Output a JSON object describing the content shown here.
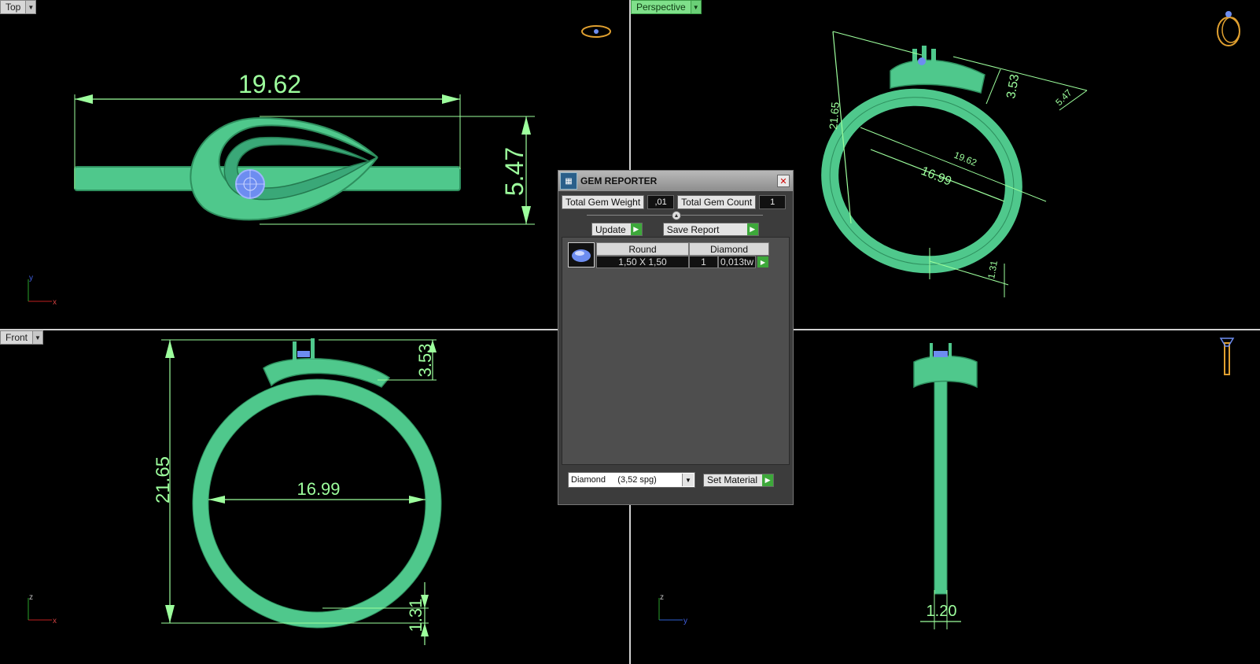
{
  "viewports": {
    "top": {
      "label": "Top",
      "dim_length": "19.62",
      "dim_width": "5.47",
      "axis_x": "x",
      "axis_y": "y"
    },
    "perspective": {
      "label": "Perspective",
      "dim_height": "21.65",
      "dim_diameter": "16.99",
      "dim_length": "19.62",
      "dim_top": "3.53",
      "dim_width": "5.47",
      "dim_shank": "1.31"
    },
    "front": {
      "label": "Front",
      "dim_height": "21.65",
      "dim_diameter": "16.99",
      "dim_top": "3.53",
      "dim_shank": "1.31",
      "axis_x": "x",
      "axis_z": "z"
    },
    "right": {
      "dim_shank_width": "1.20",
      "axis_y": "y",
      "axis_z": "z"
    }
  },
  "gem_reporter": {
    "title": "GEM REPORTER",
    "total_gem_weight_label": "Total Gem Weight",
    "total_gem_weight_value": ",01",
    "total_gem_count_label": "Total Gem Count",
    "total_gem_count_value": "1",
    "update_label": "Update",
    "save_report_label": "Save Report",
    "table": {
      "col_shape": "Round",
      "col_material": "Diamond",
      "size": "1,50 X 1,50",
      "count": "1",
      "weight": "0,013tw"
    },
    "material_select": "Diamond     (3,52 spg)",
    "set_material_label": "Set Material"
  },
  "colors": {
    "ring": "#4fc88c",
    "dimension": "#9dff9d",
    "gem": "#6d8df0",
    "label_green": "#7fe08a"
  },
  "icons": [
    "ring-top-icon",
    "ring-perspective-icon",
    "ring-side-icon",
    "dropdown-arrow-icon",
    "close-icon",
    "go-arrow-icon",
    "gem-thumbnail-icon"
  ]
}
